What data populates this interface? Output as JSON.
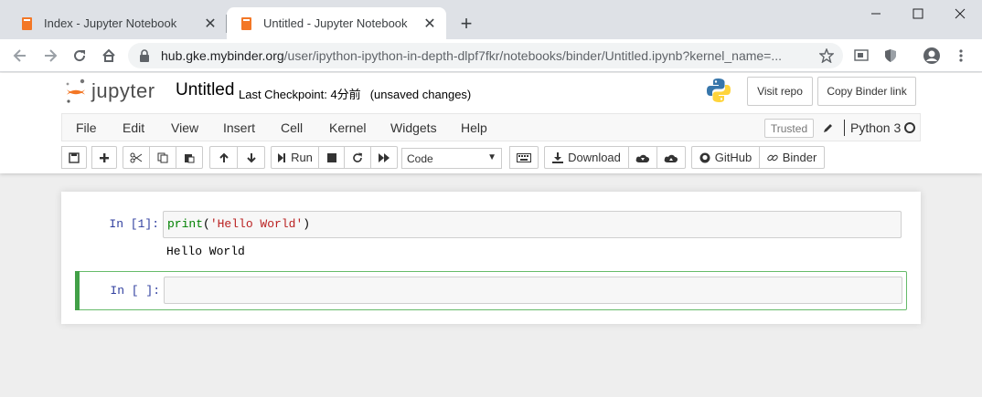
{
  "browser": {
    "tabs": [
      {
        "title": "Index - Jupyter Notebook",
        "active": false
      },
      {
        "title": "Untitled - Jupyter Notebook",
        "active": true
      }
    ],
    "address": {
      "host": "hub.gke.mybinder.org",
      "path": "/user/ipython-ipython-in-depth-dlpf7fkr/notebooks/binder/Untitled.ipynb?kernel_name=..."
    }
  },
  "header": {
    "logo_text": "jupyter",
    "notebook_title": "Untitled",
    "checkpoint_text": "Last Checkpoint: 4分前",
    "unsaved_text": "(unsaved changes)",
    "visit_repo_label": "Visit repo",
    "copy_binder_label": "Copy Binder link"
  },
  "menubar": {
    "items": [
      "File",
      "Edit",
      "View",
      "Insert",
      "Cell",
      "Kernel",
      "Widgets",
      "Help"
    ],
    "trusted_label": "Trusted",
    "kernel_name": "Python 3"
  },
  "toolbar": {
    "run_label": "Run",
    "cell_type": "Code",
    "download_label": "Download",
    "github_label": "GitHub",
    "binder_label": "Binder"
  },
  "cells": [
    {
      "prompt": "In [1]:",
      "code_func": "print",
      "code_open": "(",
      "code_str": "'Hello World'",
      "code_close": ")",
      "output": "Hello World"
    },
    {
      "prompt": "In [ ]:",
      "code": ""
    }
  ],
  "colors": {
    "accent_orange": "#f37726",
    "selected_cell_border": "#66bb6a",
    "prompt_blue": "#303f9f"
  }
}
